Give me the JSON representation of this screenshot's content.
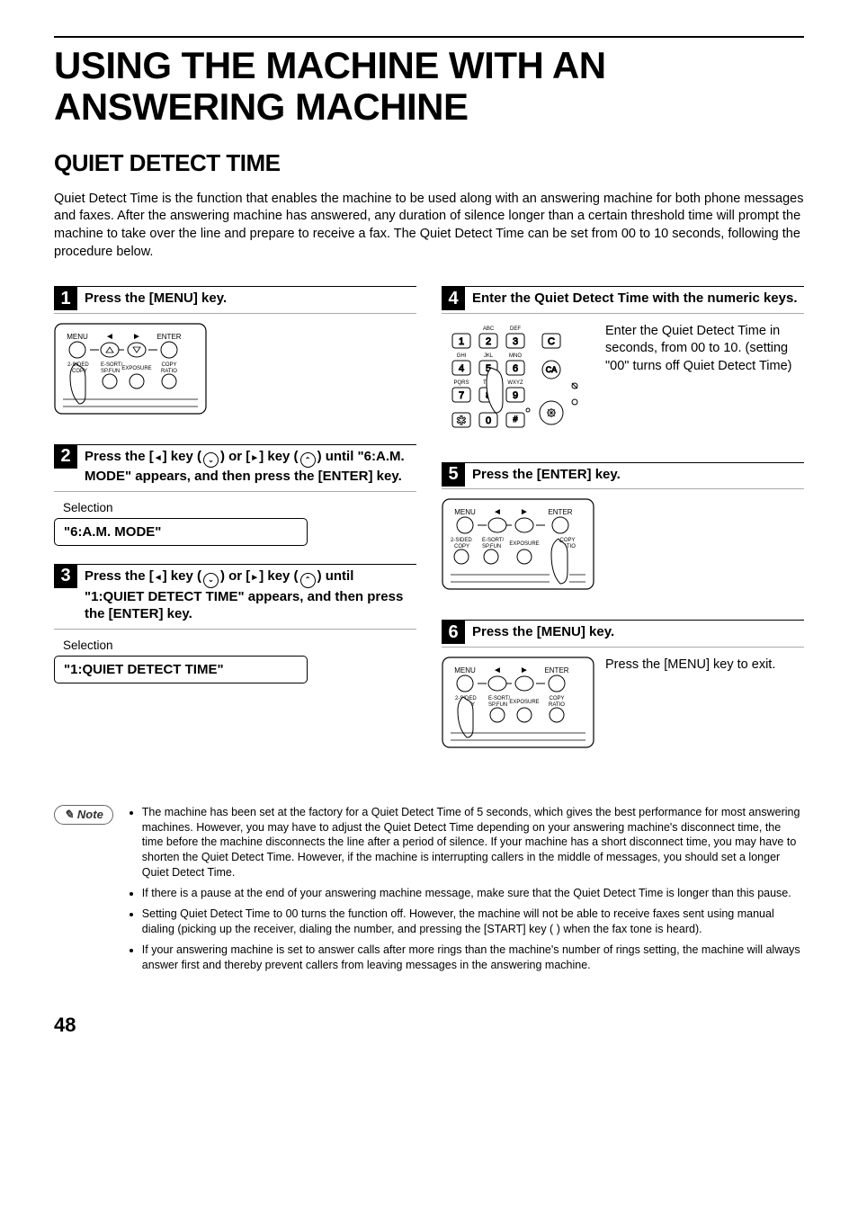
{
  "title": "USING THE MACHINE WITH AN ANSWERING MACHINE",
  "subtitle": "QUIET DETECT TIME",
  "intro": "Quiet Detect Time is the function that enables the machine to be used along with an answering machine for both phone messages and faxes. After the answering machine has answered, any duration of silence longer than a certain threshold time will prompt the machine to take over the line and prepare to receive a fax. The Quiet Detect Time can be set from 00 to 10 seconds, following the procedure below.",
  "steps": {
    "s1": {
      "num": "1",
      "title": "Press the [MENU] key."
    },
    "s2": {
      "num": "2",
      "title_pre": "Press the [",
      "title_mid1": "] key (",
      "title_mid2": ") or [",
      "title_mid3": "] key (",
      "title_post": ") until \"6:A.M. MODE\" appears, and then press the [ENTER] key.",
      "sel_label": "Selection",
      "display": "\"6:A.M. MODE\""
    },
    "s3": {
      "num": "3",
      "title_pre": "Press the [",
      "title_mid1": "] key (",
      "title_mid2": ") or [",
      "title_mid3": "] key (",
      "title_post": ") until \"1:QUIET DETECT TIME\" appears, and then press the [ENTER] key.",
      "sel_label": "Selection",
      "display": "\"1:QUIET DETECT TIME\""
    },
    "s4": {
      "num": "4",
      "title": "Enter the Quiet Detect Time with the numeric keys.",
      "body": "Enter the Quiet Detect Time in seconds, from 00 to 10. (setting \"00\" turns off Quiet Detect Time)"
    },
    "s5": {
      "num": "5",
      "title": "Press the [ENTER] key."
    },
    "s6": {
      "num": "6",
      "title": "Press the [MENU] key.",
      "body": "Press the [MENU] key to exit."
    }
  },
  "note_label": "Note",
  "notes": [
    "The machine has been set at the factory for a Quiet Detect Time of 5 seconds, which gives the best performance for most answering machines. However, you may have to adjust the Quiet Detect Time depending on your answering machine's disconnect time, the time before the machine disconnects the line after a period of silence. If your machine has a short disconnect time, you may have to shorten the Quiet Detect Time. However, if the machine is interrupting callers in the middle of messages, you should set a longer Quiet Detect Time.",
    "If there is a pause at the end of your answering machine message, make sure that the Quiet Detect Time is longer than this pause.",
    "Setting Quiet Detect Time to 00 turns the function off. However, the machine will not be able to receive faxes sent using manual dialing (picking up the receiver, dialing the number, and pressing the [START] key ( ) when the fax tone is heard).",
    "If your answering machine is set to answer calls after more rings than the machine's number of rings setting, the machine will always answer first and thereby prevent callers from leaving messages in the answering machine."
  ],
  "page_number": "48"
}
